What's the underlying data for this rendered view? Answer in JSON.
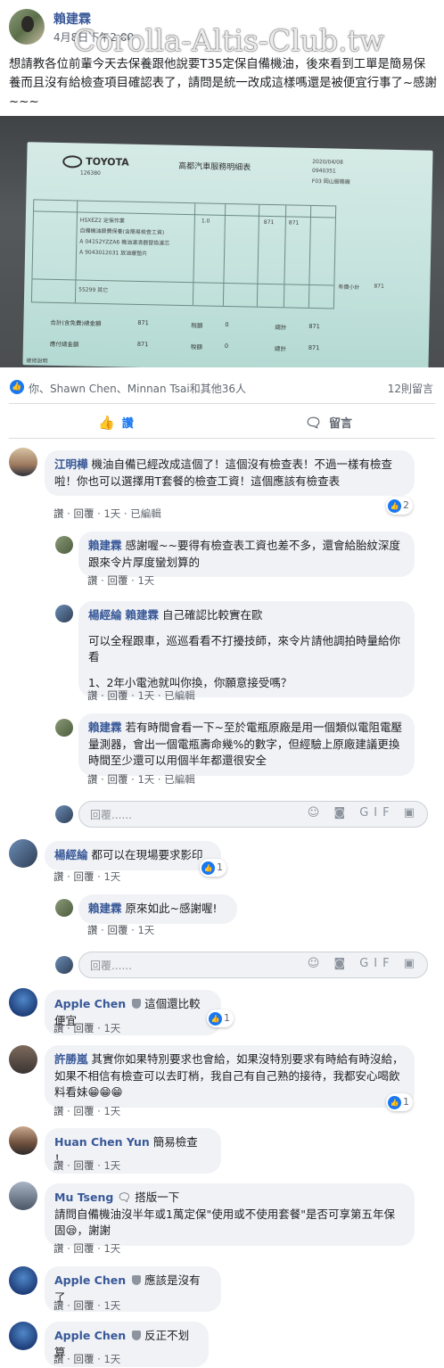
{
  "post": {
    "author": "賴建霖",
    "time": "4月8日下午2:00",
    "watermark": "Corolla-Altis-Club.tw",
    "text": "想請教各位前輩今天去保養跟他說要T35定保自備機油，後來看到工單是簡易保養而且沒有給檢查項目確認表了，請問是統一改成這樣嗎還是被便宜行事了~感謝~~~"
  },
  "receipt": {
    "brand": "TOYOTA",
    "title": "高都汽車服務明細表",
    "date": "2020/04/08",
    "order_no": "0940351",
    "mileage": "126380",
    "branch": "F03 岡山服務廠",
    "row1_code": "HSXEZ2 定保作業",
    "row2": "自備機油節費保養(含簡易檢查工資)",
    "row3": "A 04152YZZA6 機油濾清器替換濾芯",
    "row4": "A 9043012031 放油塞墊片",
    "qty": "1.0",
    "price": "871",
    "amount": "871",
    "subtotal_label": "有價小計",
    "subtotal": "871",
    "misc": "55299 其它",
    "total_label": "合計(含免費)總金額",
    "total": "871",
    "tax_label": "稅額",
    "tax": "0",
    "grand_label": "總計",
    "grand": "871",
    "pay_label": "應付總金額",
    "footer": "維修說明"
  },
  "reactions": {
    "like_icon": "👍",
    "love_icon": "♥",
    "text": "你、Shawn Chen、Minnan Tsai和其他36人",
    "comments": "12則留言"
  },
  "actions": {
    "like": "讚",
    "comment": "留言"
  },
  "meta_labels": {
    "like": "讚",
    "reply": "回覆",
    "edited": "已編輯",
    "reply_placeholder": "回覆......"
  },
  "comments": [
    {
      "name": "江明樺",
      "text": "機油自備已經改成這個了！這個沒有檢查表！不過一樣有檢查啦！你也可以選擇用T套餐的檢查工資！這個應該有檢查表",
      "time": "1天",
      "reacts": "2"
    },
    {
      "name": "賴建霖",
      "text": "感謝喔~~要得有檢查表工資也差不多，還會給胎紋深度跟來令片厚度蠻划算的",
      "time": "1天"
    },
    {
      "name": "楊經綸",
      "tag": "賴建霖",
      "text": "自己確認比較實在歐",
      "text2": "可以全程跟車，巡巡看看不打擾技師，來令片請他調拍時量給你看",
      "text3": "1、2年小電池就叫你換，你願意接受嗎？",
      "time": "1天"
    },
    {
      "name": "賴建霖",
      "text": "若有時間會看一下~至於電瓶原廠是用一個類似電阻電壓量測器，會出一個電瓶壽命幾%的數字，但經驗上原廠建議更換時間至少還可以用個半年都還很安全",
      "time": "1天"
    },
    {
      "name": "楊經綸",
      "text": "都可以在現場要求影印",
      "time": "1天",
      "reacts": "1"
    },
    {
      "name": "賴建霖",
      "text": "原來如此~感謝喔!",
      "time": "1天"
    },
    {
      "name": "Apple Chen",
      "text": "這個還比較便宜",
      "time": "1天",
      "reacts": "1"
    },
    {
      "name": "許勝嵐",
      "text": "其實你如果特別要求也會給，如果沒特別要求有時給有時沒給，如果不相信有檢查可以去盯梢，我自己有自己熟的接待，我都安心喝飲料看妹😁😁😁",
      "time": "1天",
      "reacts": "1"
    },
    {
      "name": "Huan Chen Yun",
      "text": "簡易檢查 ！",
      "time": "1天"
    },
    {
      "name": "Mu Tseng",
      "badge": "🗨",
      "text": "搭版一下",
      "text2": "請問自備機油沒半年或1萬定保\"使用或不使用套餐\"是否可享第五年保固😪，謝謝",
      "time": "1天"
    },
    {
      "name": "Apple Chen",
      "text": "應該是沒有了",
      "time": "1天"
    },
    {
      "name": "Apple Chen",
      "text": "反正不划算",
      "time": "1天"
    }
  ],
  "icons": {
    "reply_tools": "☺ ◙ GIF ▣"
  }
}
